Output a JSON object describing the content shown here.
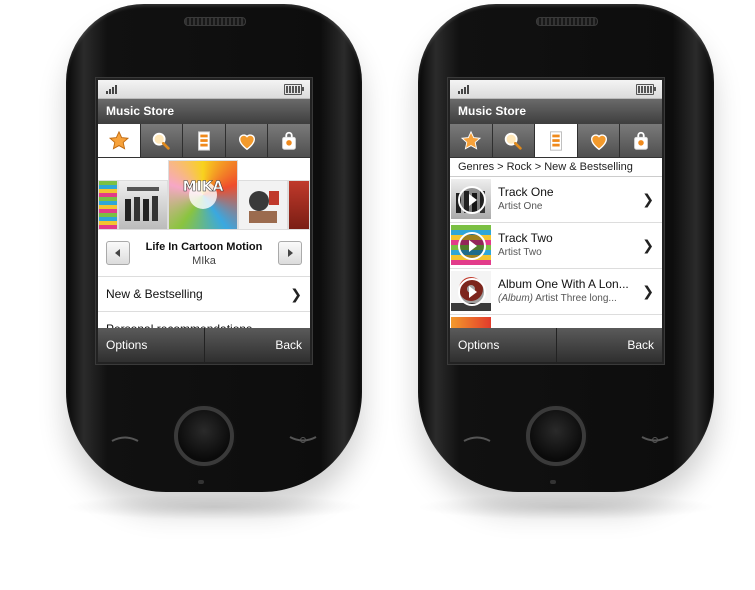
{
  "phone1": {
    "title": "Music Store",
    "tabs": [
      {
        "icon": "star-icon",
        "active": true
      },
      {
        "icon": "search-icon",
        "active": false
      },
      {
        "icon": "genres-icon",
        "active": false
      },
      {
        "icon": "heart-icon",
        "active": false
      },
      {
        "icon": "bag-icon",
        "active": false
      }
    ],
    "album": {
      "title": "Life In Cartoon Motion",
      "artist": "MIka"
    },
    "menu": [
      {
        "label": "New & Bestselling"
      },
      {
        "label": "Personal recommendations"
      }
    ],
    "softkeys": {
      "left": "Options",
      "right": "Back"
    }
  },
  "phone2": {
    "title": "Music Store",
    "tabs": [
      {
        "icon": "star-icon",
        "active": false
      },
      {
        "icon": "search-icon",
        "active": false
      },
      {
        "icon": "genres-icon",
        "active": true
      },
      {
        "icon": "heart-icon",
        "active": false
      },
      {
        "icon": "bag-icon",
        "active": false
      }
    ],
    "breadcrumb": "Genres > Rock > New & Bestselling",
    "tracks": [
      {
        "title": "Track One",
        "subtitle": "Artist One",
        "subtitle_prefix": ""
      },
      {
        "title": "Track Two",
        "subtitle": "Artist Two",
        "subtitle_prefix": ""
      },
      {
        "title": "Album One With A Lon...",
        "subtitle": "Artist Three long...",
        "subtitle_prefix": "(Album)"
      }
    ],
    "softkeys": {
      "left": "Options",
      "right": "Back"
    }
  },
  "colors": {
    "accent_orange": "#f08a1c",
    "bar_dark": "#3e3e3e"
  }
}
